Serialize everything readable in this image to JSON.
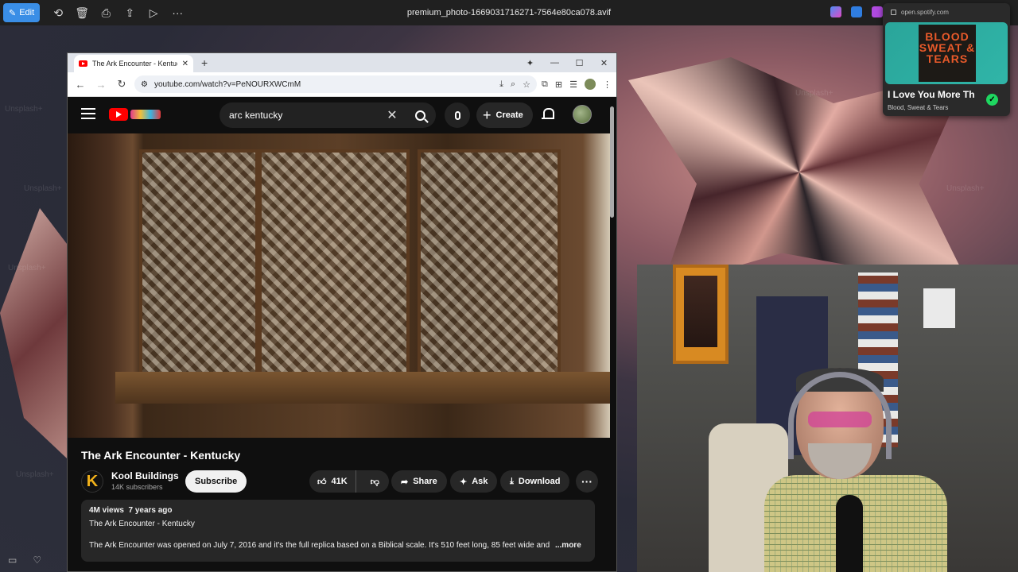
{
  "viewer": {
    "edit_label": "Edit",
    "file_name": "premium_photo-1669031716271-7564e80ca078.avif"
  },
  "browser": {
    "tab_title": "The Ark Encounter - Kentucky",
    "url": "youtube.com/watch?v=PeNOURXWCmM"
  },
  "youtube": {
    "search_value": "arc kentucky",
    "create_label": "Create",
    "video": {
      "title": "The Ark Encounter - Kentucky",
      "channel_name": "Kool Buildings",
      "channel_initial": "K",
      "subscribers": "14K subscribers",
      "subscribe_label": "Subscribe",
      "likes": "41K",
      "share_label": "Share",
      "ask_label": "Ask",
      "download_label": "Download",
      "views": "4M views",
      "age": "7 years ago",
      "desc_title": "The Ark Encounter - Kentucky",
      "desc_body": "The Ark Encounter was opened on July 7, 2016 and it's the full replica based on a Biblical scale. It's 510 feet long, 85 feet wide and",
      "more_label": "...more"
    }
  },
  "spotify": {
    "host": "open.spotify.com",
    "song": "I Love You More Th",
    "artist": "Blood, Sweat & Tears",
    "album_text": "BLOOD SWEAT & TEARS"
  },
  "watermark": "Unsplash+"
}
